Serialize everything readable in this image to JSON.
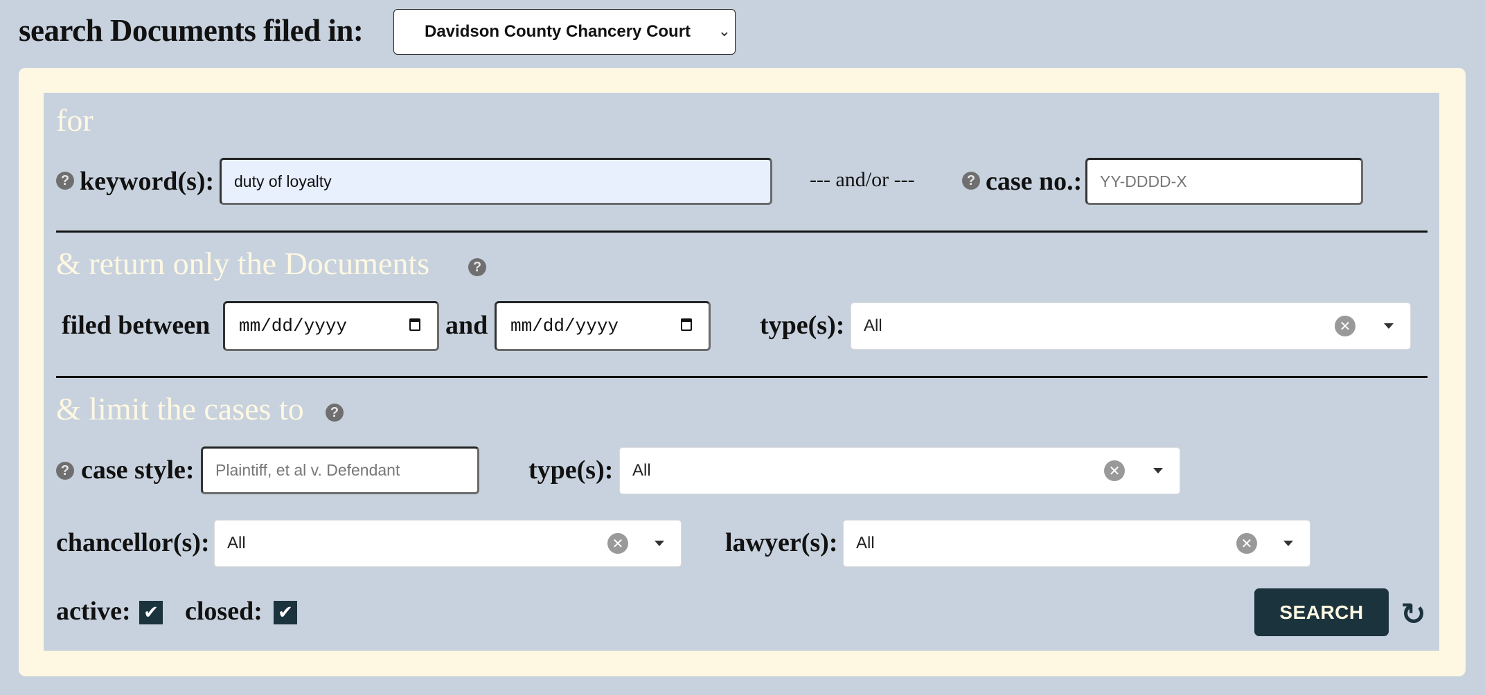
{
  "header": {
    "title": "search Documents filed in:",
    "court_select": {
      "value": "Davidson County Chancery Court",
      "icon": "chevron-down-icon"
    }
  },
  "section_for": {
    "heading": "for",
    "keyword": {
      "label": "keyword(s):",
      "value": "duty of loyalty",
      "help_icon": "?"
    },
    "separator": "--- and/or ---",
    "case_no": {
      "label": "case no.:",
      "placeholder": "YY-DDDD-X",
      "value": "",
      "help_icon": "?"
    }
  },
  "section_documents": {
    "heading": "& return only the Documents",
    "help_icon": "?",
    "filed_between_label": "filed between",
    "date_from": {
      "placeholder": "mm/dd/yyyy",
      "value": ""
    },
    "and_label": "and",
    "date_to": {
      "placeholder": "mm/dd/yyyy",
      "value": ""
    },
    "types": {
      "label": "type(s):",
      "value": "All"
    }
  },
  "section_cases": {
    "heading": "& limit the cases to",
    "help_icon": "?",
    "case_style": {
      "label": "case style:",
      "placeholder": "Plaintiff, et al v. Defendant",
      "value": "",
      "help_icon": "?"
    },
    "types": {
      "label": "type(s):",
      "value": "All"
    },
    "chancellors": {
      "label": "chancellor(s):",
      "value": "All"
    },
    "lawyers": {
      "label": "lawyer(s):",
      "value": "All"
    },
    "active": {
      "label": "active:",
      "checked": true,
      "mark": "✔"
    },
    "closed": {
      "label": "closed:",
      "checked": true,
      "mark": "✔"
    }
  },
  "actions": {
    "search_label": "SEARCH",
    "reset_icon": "↻"
  },
  "colors": {
    "background": "#c8d2de",
    "frame": "#fef8e2",
    "accent_dark": "#1b333d",
    "heading_cream": "#fef8e2",
    "keyword_fill": "#e8effd"
  }
}
